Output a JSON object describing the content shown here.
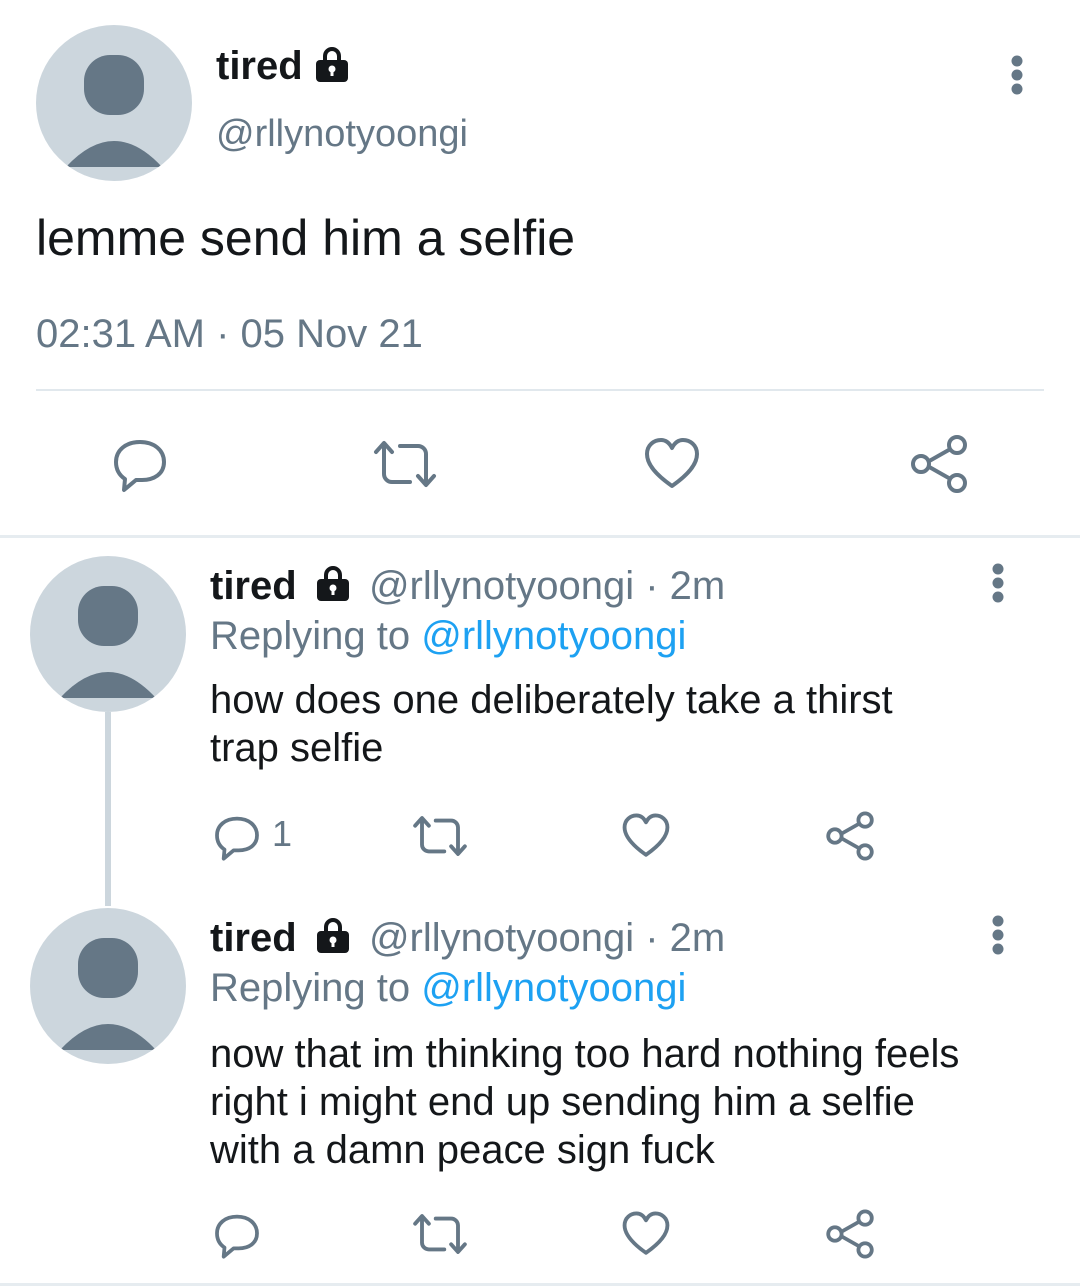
{
  "main_tweet": {
    "display_name": "tired",
    "handle": "@rllynotyoongi",
    "text": "lemme send him a selfie",
    "timestamp": "02:31 AM · 05 Nov 21",
    "actions": [
      "reply-icon",
      "retweet-icon",
      "like-icon",
      "share-icon"
    ]
  },
  "replies": [
    {
      "display_name": "tired",
      "handle": "@rllynotyoongi",
      "time": "· 2m",
      "replying_prefix": "Replying to ",
      "replying_to": "@rllynotyoongi",
      "text_lines": [
        "how does one deliberately take a thirst",
        "trap selfie"
      ],
      "reply_count": "1"
    },
    {
      "display_name": "tired",
      "handle": "@rllynotyoongi",
      "time": "· 2m",
      "replying_prefix": "Replying to ",
      "replying_to": "@rllynotyoongi",
      "text_lines": [
        "now that im thinking too hard nothing feels",
        "right i might end up sending him a selfie",
        "with a damn peace sign fuck"
      ],
      "reply_count": ""
    }
  ],
  "colors": {
    "text": "#14171a",
    "muted": "#657786",
    "link": "#1da1f2",
    "avatar_bg": "#ccd6dd",
    "avatar_fg": "#657786",
    "divider": "#e1e8ed"
  }
}
